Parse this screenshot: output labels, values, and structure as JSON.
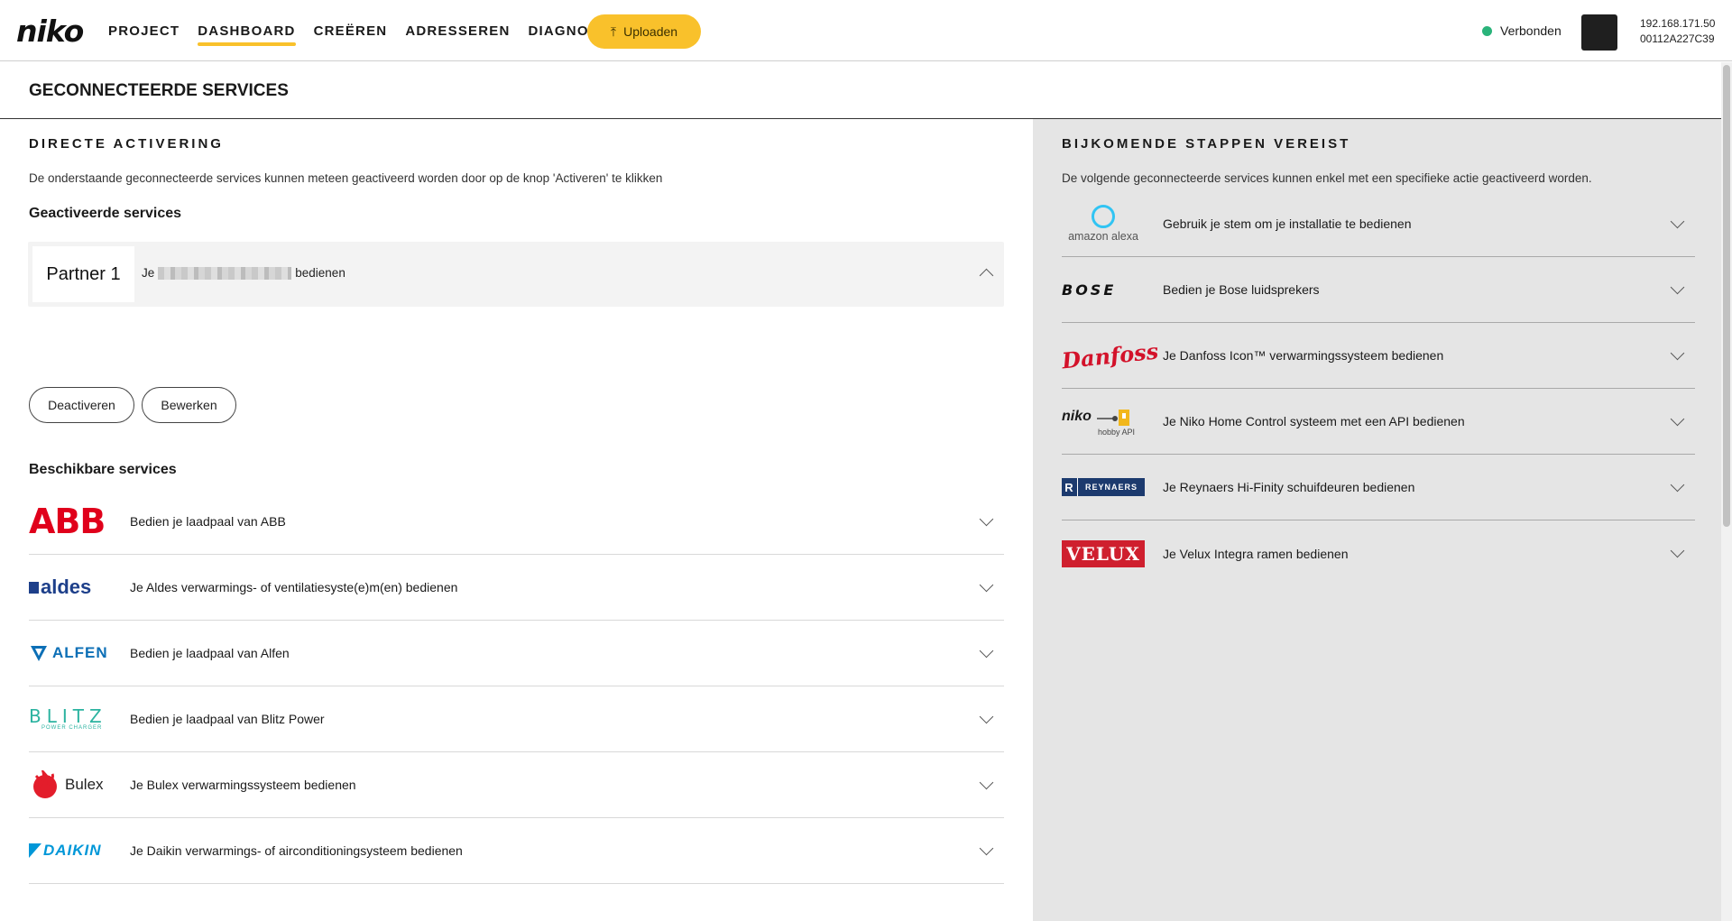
{
  "app": {
    "logo_text": "niko"
  },
  "nav": {
    "items": [
      {
        "label": "PROJECT",
        "active": false
      },
      {
        "label": "DASHBOARD",
        "active": true
      },
      {
        "label": "CREËREN",
        "active": false
      },
      {
        "label": "ADRESSEREN",
        "active": false
      },
      {
        "label": "DIAGNOSE",
        "active": false
      }
    ],
    "upload_label": "Uploaden",
    "accent_color": "#f9c12b"
  },
  "status": {
    "label": "Verbonden",
    "color": "#2ab37a"
  },
  "device": {
    "ip": "192.168.171.50",
    "id": "00112A227C39"
  },
  "page": {
    "title": "GECONNECTEERDE SERVICES"
  },
  "direct": {
    "heading": "DIRECTE ACTIVERING",
    "description": "De onderstaande geconnecteerde services kunnen meteen geactiveerd worden door op de knop 'Activeren' te klikken",
    "activated_heading": "Geactiveerde services",
    "partner": {
      "logo_text": "Partner 1",
      "text_before": "Je",
      "text_after": "bedienen"
    },
    "buttons": {
      "deactivate": "Deactiveren",
      "edit": "Bewerken"
    },
    "available_heading": "Beschikbare services",
    "services": [
      {
        "logo": "ABB",
        "label": "Bedien je laadpaal van ABB"
      },
      {
        "logo": "aldes",
        "label": "Je Aldes verwarmings- of ventilatiesyste(e)m(en) bedienen"
      },
      {
        "logo": "ALFEN",
        "label": "Bedien je laadpaal van Alfen"
      },
      {
        "logo": "BLITZ",
        "logo_sub": "POWER CHARGER",
        "label": "Bedien je laadpaal van Blitz Power"
      },
      {
        "logo": "Bulex",
        "label": "Je Bulex verwarmingssysteem bedienen"
      },
      {
        "logo": "DAIKIN",
        "label": "Je Daikin verwarmings- of airconditioningsysteem bedienen"
      }
    ]
  },
  "additional": {
    "heading": "BIJKOMENDE STAPPEN VEREIST",
    "description": "De volgende geconnecteerde services kunnen enkel met een specifieke actie geactiveerd worden.",
    "services": [
      {
        "logo": "amazon alexa",
        "label": "Gebruik je stem om je installatie te bedienen"
      },
      {
        "logo": "BOSE",
        "label": "Bedien je Bose luidsprekers"
      },
      {
        "logo": "Danfoss",
        "label": "Je Danfoss Icon™ verwarmingssysteem bedienen"
      },
      {
        "logo": "niko",
        "logo_sub": "hobby API",
        "label": "Je Niko Home Control systeem met een API bedienen"
      },
      {
        "logo": "REYNAERS",
        "logo_mark": "R",
        "label": "Je Reynaers Hi-Finity schuifdeuren bedienen"
      },
      {
        "logo": "VELUX",
        "label": "Je Velux Integra ramen bedienen"
      }
    ]
  }
}
